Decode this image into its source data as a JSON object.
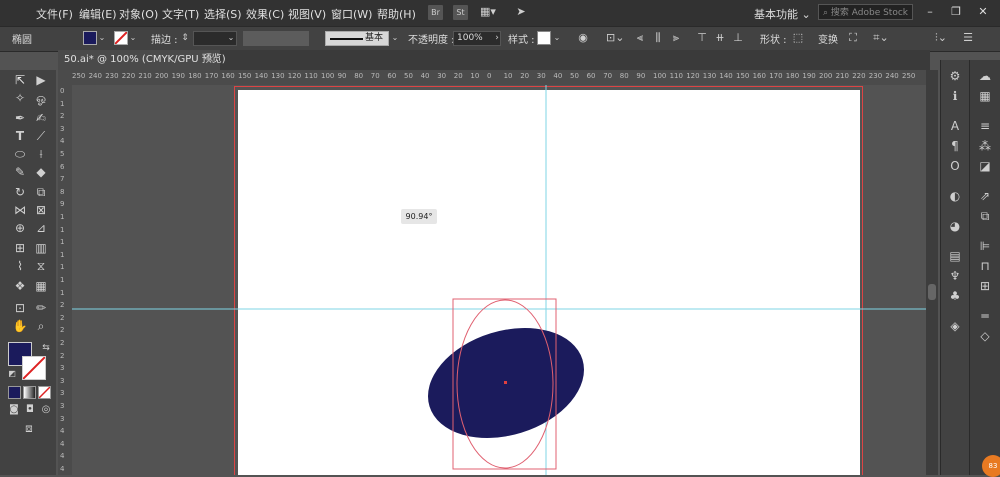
{
  "menu": {
    "items": [
      "文件(F)",
      "编辑(E)",
      "对象(O)",
      "文字(T)",
      "选择(S)",
      "效果(C)",
      "视图(V)",
      "窗口(W)",
      "帮助(H)"
    ],
    "bridge_label": "Br",
    "stock_label": "St",
    "workspace": "基本功能",
    "search_placeholder": "搜索 Adobe Stock"
  },
  "control": {
    "panel_label": "椭圆",
    "fill_color": "#1b1b5c",
    "stroke_label": "描边 :",
    "stroke_style": "基本",
    "opacity_label": "不透明度 :",
    "opacity_value": "100%",
    "style_label": "样式 :",
    "shape_label": "形状 :",
    "transform_label": "变换"
  },
  "document": {
    "tab_title": "50.ai* @ 100% (CMYK/GPU 预览)",
    "close": "×"
  },
  "ruler": {
    "h_ticks": [
      "250",
      "240",
      "230",
      "220",
      "210",
      "200",
      "190",
      "180",
      "170",
      "160",
      "150",
      "140",
      "130",
      "120",
      "110",
      "100",
      "90",
      "80",
      "70",
      "60",
      "50",
      "40",
      "30",
      "20",
      "10",
      "0",
      "10",
      "20",
      "30",
      "40",
      "50",
      "60",
      "70",
      "80",
      "90",
      "100",
      "110",
      "120",
      "130",
      "140",
      "150",
      "160",
      "170",
      "180",
      "190",
      "200",
      "210",
      "220",
      "230",
      "240",
      "250"
    ],
    "v_ticks": [
      "0",
      "1",
      "2",
      "3",
      "4",
      "5",
      "6",
      "7",
      "8",
      "9",
      "1",
      "1",
      "1",
      "1",
      "1",
      "1",
      "1",
      "2",
      "2",
      "2",
      "2",
      "2",
      "3",
      "3",
      "3",
      "3",
      "3",
      "4",
      "4",
      "4",
      "4"
    ]
  },
  "canvas": {
    "angle_readout": "90.94°",
    "ellipse_color": "#1b1b5c",
    "guide_color": "#7fd6e6",
    "bbox_color": "#e06070"
  },
  "colors": {
    "accent": "#1b1b5c",
    "artboard_border": "#dd4444"
  },
  "corner_badge": "83"
}
